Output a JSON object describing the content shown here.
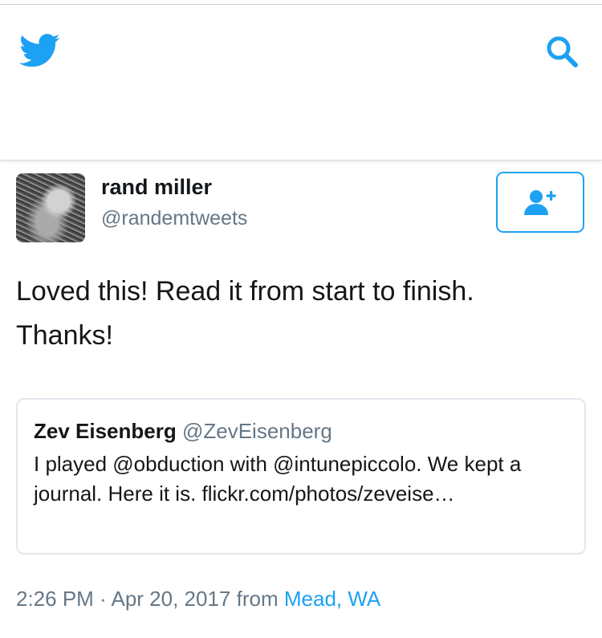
{
  "icons": {
    "logo": "twitter-bird-icon",
    "search": "search-icon",
    "follow": "add-user-icon"
  },
  "colors": {
    "accent": "#1da1f2",
    "text": "#14171a",
    "secondary": "#657786",
    "border": "#e1e8ed"
  },
  "tweet": {
    "author_name": "rand miller",
    "author_handle": "@randemtweets",
    "text": "Loved this! Read it from start to finish. Thanks!",
    "timestamp": "2:26 PM · Apr 20, 2017",
    "from_label": "from",
    "location": "Mead, WA"
  },
  "quoted": {
    "author_name": "Zev Eisenberg",
    "author_handle": "@ZevEisenberg",
    "text": "I played @obduction with @intunepiccolo. We kept a journal. Here it is. flickr.com/photos/zeveise…"
  }
}
